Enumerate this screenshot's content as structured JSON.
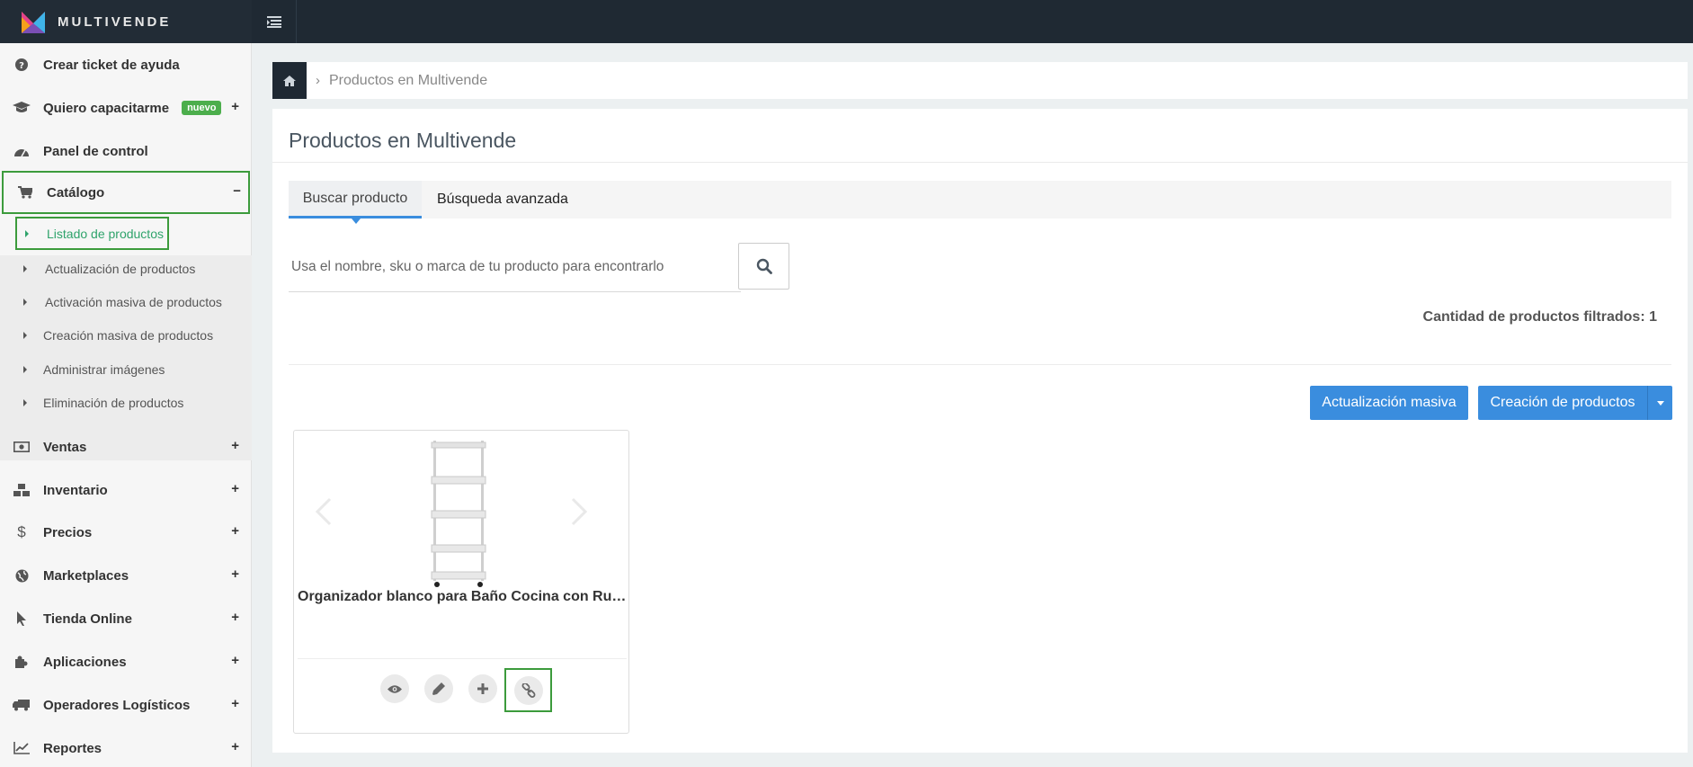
{
  "brand": {
    "name": "MULTIVENDE"
  },
  "sidebar": {
    "items": [
      {
        "label": "Crear ticket de ayuda",
        "icon": "question-circle-icon"
      },
      {
        "label": "Quiero capacitarme",
        "icon": "graduation-cap-icon",
        "badge": "nuevo",
        "toggle": "+"
      },
      {
        "label": "Panel de control",
        "icon": "dashboard-icon"
      },
      {
        "label": "Catálogo",
        "icon": "shopping-cart-icon",
        "toggle": "−"
      },
      {
        "label": "Ventas",
        "icon": "money-icon",
        "toggle": "+"
      },
      {
        "label": "Inventario",
        "icon": "cubes-icon",
        "toggle": "+"
      },
      {
        "label": "Precios",
        "icon": "dollar-icon",
        "toggle": "+"
      },
      {
        "label": "Marketplaces",
        "icon": "globe-icon",
        "toggle": "+"
      },
      {
        "label": "Tienda Online",
        "icon": "pointer-icon",
        "toggle": "+"
      },
      {
        "label": "Aplicaciones",
        "icon": "puzzle-icon",
        "toggle": "+"
      },
      {
        "label": "Operadores Logísticos",
        "icon": "truck-icon",
        "toggle": "+"
      },
      {
        "label": "Reportes",
        "icon": "line-chart-icon",
        "toggle": "+"
      }
    ],
    "catalog_sub": [
      {
        "label": "Listado de productos"
      },
      {
        "label": "Actualización de productos"
      },
      {
        "label": "Activación masiva de productos"
      },
      {
        "label": "Creación masiva de productos"
      },
      {
        "label": "Administrar imágenes"
      },
      {
        "label": "Eliminación de productos"
      }
    ]
  },
  "breadcrumb": {
    "current": "Productos en Multivende"
  },
  "main": {
    "title": "Productos en Multivende",
    "tabs": [
      {
        "label": "Buscar producto"
      },
      {
        "label": "Búsqueda avanzada"
      }
    ],
    "search": {
      "placeholder": "Usa el nombre, sku o marca de tu producto para encontrarlo",
      "value": ""
    },
    "count_text": "Cantidad de productos filtrados: 1",
    "buttons": {
      "mass_update": "Actualización masiva",
      "create_products": "Creación de productos"
    },
    "product": {
      "title": "Organizador blanco para Baño Cocina con Ruedas"
    }
  },
  "colors": {
    "topbar": "#1f2933",
    "accent_blue": "#3a8dde",
    "highlight_green": "#3c9b3c",
    "badge_green": "#4cae4c",
    "active_sub_text": "#2fa36b"
  }
}
